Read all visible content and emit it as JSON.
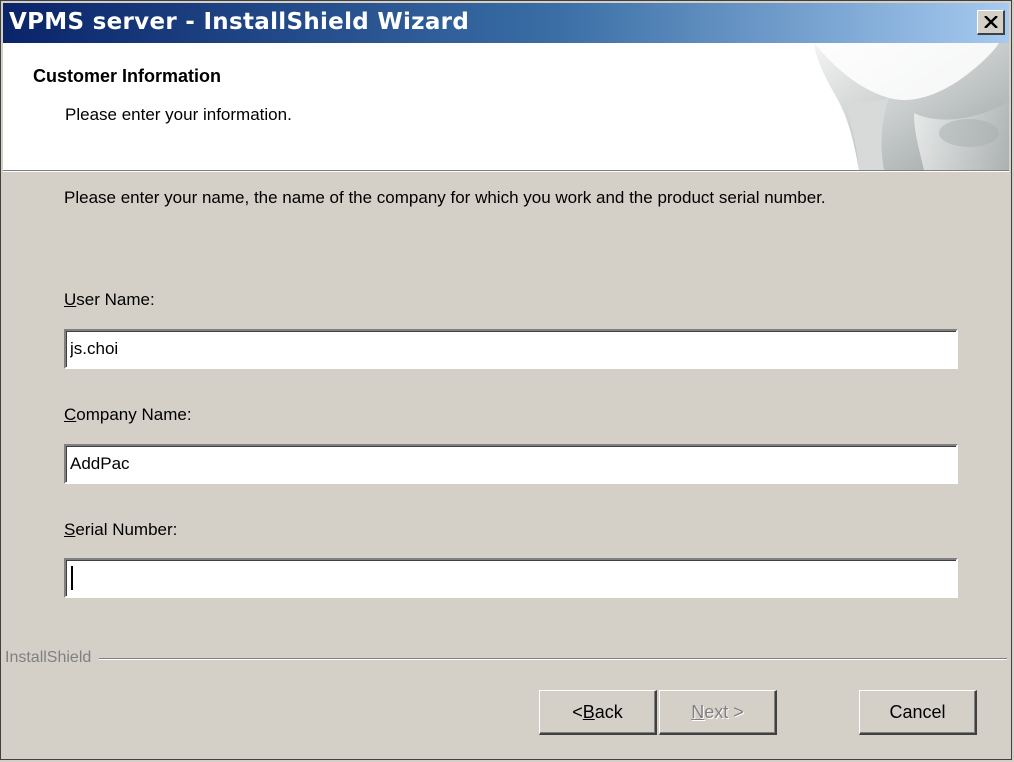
{
  "window": {
    "title": "VPMS server - InstallShield Wizard",
    "close_icon": "close-icon"
  },
  "header": {
    "title": "Customer Information",
    "subtitle": "Please enter your information."
  },
  "instructions": "Please enter your name, the name of the company for which you work and the product serial number.",
  "fields": {
    "user_name": {
      "label_mnemonic": "U",
      "label_rest": "ser Name:",
      "value": "js.choi"
    },
    "company_name": {
      "label_mnemonic": "C",
      "label_rest": "ompany Name:",
      "value": "AddPac"
    },
    "serial_number": {
      "label_mnemonic": "S",
      "label_rest": "erial Number:",
      "value": ""
    }
  },
  "brand": "InstallShield",
  "buttons": {
    "back": {
      "prefix": "< ",
      "mnemonic": "B",
      "rest": "ack"
    },
    "next": {
      "mnemonic": "N",
      "rest": "ext >"
    },
    "cancel": {
      "label": "Cancel"
    }
  }
}
